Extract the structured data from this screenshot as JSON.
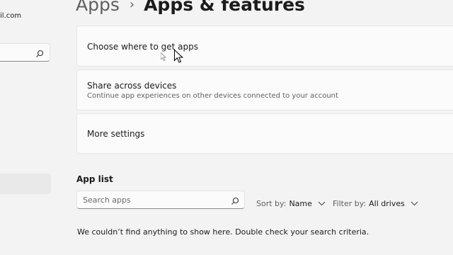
{
  "account": {
    "email_fragment": "il.com"
  },
  "sidebar": {
    "search": {
      "icon": "search-icon"
    },
    "selected_item": {
      "label": ""
    }
  },
  "breadcrumb": {
    "parent": "Apps",
    "separator": "›",
    "current": "Apps & features"
  },
  "settings": {
    "choose_where": {
      "title": "Choose where to get apps"
    },
    "share_across": {
      "title": "Share across devices",
      "subtitle": "Continue app experiences on other devices connected to your account"
    },
    "more_settings": {
      "title": "More settings"
    }
  },
  "app_list": {
    "title": "App list",
    "search": {
      "placeholder": "Search apps",
      "icon": "search-icon"
    },
    "sort": {
      "label": "Sort by:",
      "value": "Name",
      "icon": "chevron-down-icon"
    },
    "filter": {
      "label": "Filter by:",
      "value": "All drives",
      "icon": "chevron-down-icon"
    },
    "empty_message": "We couldn’t find anything to show here. Double check your search criteria."
  },
  "colors": {
    "background": "#f3f3f3",
    "card": "#fbfbfb",
    "text": "#1b1b1b",
    "secondary_text": "#616161"
  }
}
